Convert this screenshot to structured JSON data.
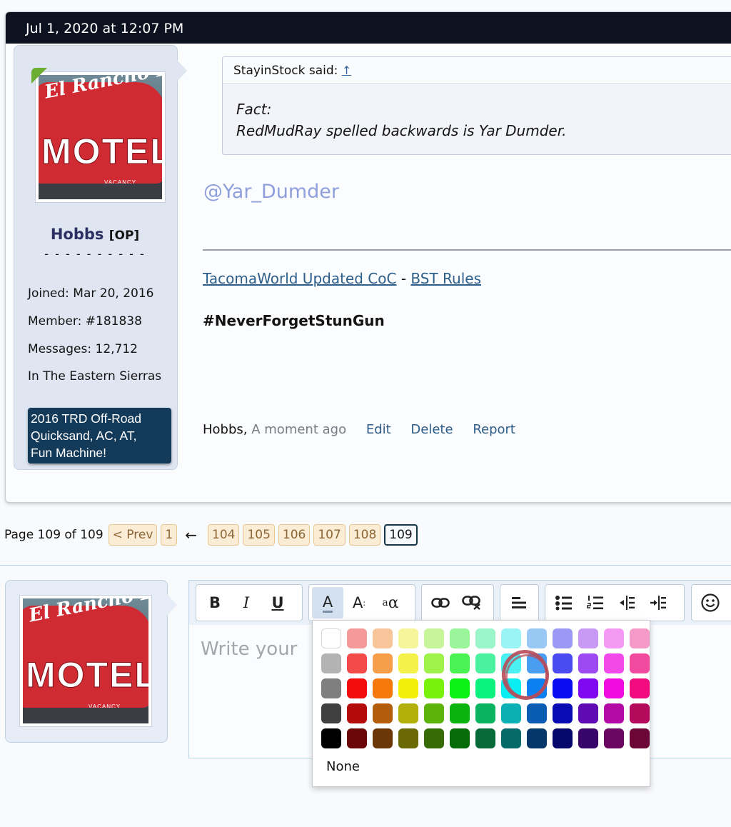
{
  "post": {
    "date": "Jul 1, 2020 at 12:07 PM",
    "user": {
      "name": "Hobbs",
      "badge": "[OP]",
      "dashes": "- - - - - - - - - -",
      "stats": [
        {
          "label": "Joined:",
          "value": "Mar 20, 2016"
        },
        {
          "label": "Member:",
          "value": "#181838"
        },
        {
          "label": "Messages:",
          "value": "12,712"
        },
        {
          "label": "",
          "value": "In The Eastern Sierras"
        }
      ],
      "vehicle_lines": [
        "2016 TRD Off-Road",
        "Quicksand, AC, AT,",
        "Fun Machine!"
      ]
    },
    "avatar_text": {
      "cursive": "El Rancho Boulder",
      "word": "MOTEL",
      "small": "VACANCY"
    },
    "quote": {
      "author_said": "StayinStock said:",
      "jump_glyph": "↑",
      "lines": [
        "Fact:",
        "RedMudRay spelled backwards is Yar Dumder."
      ]
    },
    "mention": "@Yar_Dumder",
    "signature": {
      "link1": "TacomaWorld Updated CoC",
      "separator": " - ",
      "link2": "BST Rules",
      "hashtag": "#NeverForgetStunGun"
    },
    "meta": {
      "author": "Hobbs,",
      "time": "A moment ago",
      "actions": [
        "Edit",
        "Delete",
        "Report"
      ]
    }
  },
  "pagination": {
    "label": "Page 109 of 109",
    "prev": "< Prev",
    "first": "1",
    "gap": "←",
    "pages": [
      "104",
      "105",
      "106",
      "107",
      "108"
    ],
    "current": "109"
  },
  "editor": {
    "placeholder": "Write your",
    "toolbar": {
      "bold": "B",
      "italic": "I",
      "underline": "U",
      "color": "A",
      "size": "A",
      "font": "a"
    },
    "palette": {
      "none_label": "None",
      "rows": [
        [
          "#ffffff",
          "#f59a9a",
          "#f8c49a",
          "#f7f59a",
          "#c9f59a",
          "#9af59b",
          "#9af5c9",
          "#9af4f5",
          "#9ac8f5",
          "#9a9af5",
          "#c89af5",
          "#f59af4",
          "#f59ac8"
        ],
        [
          "#b3b3b3",
          "#f34a4a",
          "#f69e4a",
          "#f4f24a",
          "#9ef24a",
          "#4af253",
          "#4af2a0",
          "#4af0f2",
          "#4a9ef2",
          "#4a4cf2",
          "#9e4af2",
          "#f24ae8",
          "#f24a9e"
        ],
        [
          "#7f7f7f",
          "#f40c0c",
          "#f57a0b",
          "#f2ef0a",
          "#78f20a",
          "#0af214",
          "#0af27e",
          "#0aeef2",
          "#0a80f2",
          "#0a0cf2",
          "#7f0af2",
          "#f20ae2",
          "#f20a7f"
        ],
        [
          "#404040",
          "#b30a0a",
          "#b35c0a",
          "#b3b00a",
          "#5cb30a",
          "#0ab30f",
          "#0ab35f",
          "#0ab0b3",
          "#0a5cb3",
          "#0a0cb3",
          "#5f0ab3",
          "#b30aa6",
          "#b30a5c"
        ],
        [
          "#000000",
          "#6b0606",
          "#6b3706",
          "#6b6906",
          "#376b06",
          "#066b09",
          "#066b39",
          "#066a6b",
          "#06376b",
          "#06076b",
          "#38066b",
          "#6b0663",
          "#6b0637"
        ]
      ]
    }
  }
}
